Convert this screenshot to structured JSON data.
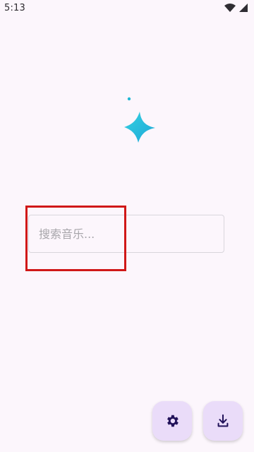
{
  "status_bar": {
    "time": "5:13",
    "icons": [
      "wifi-icon",
      "signal-icon"
    ]
  },
  "logo": {
    "icon": "sparkle-icon",
    "colors": [
      "#35d1e0",
      "#1ea7d8"
    ]
  },
  "search": {
    "placeholder": "搜索音乐..."
  },
  "highlight_color": "#d01818",
  "fabs": {
    "settings_icon": "gear-icon",
    "download_icon": "download-icon",
    "background": "#eadcf9",
    "icon_color": "#22135a"
  }
}
